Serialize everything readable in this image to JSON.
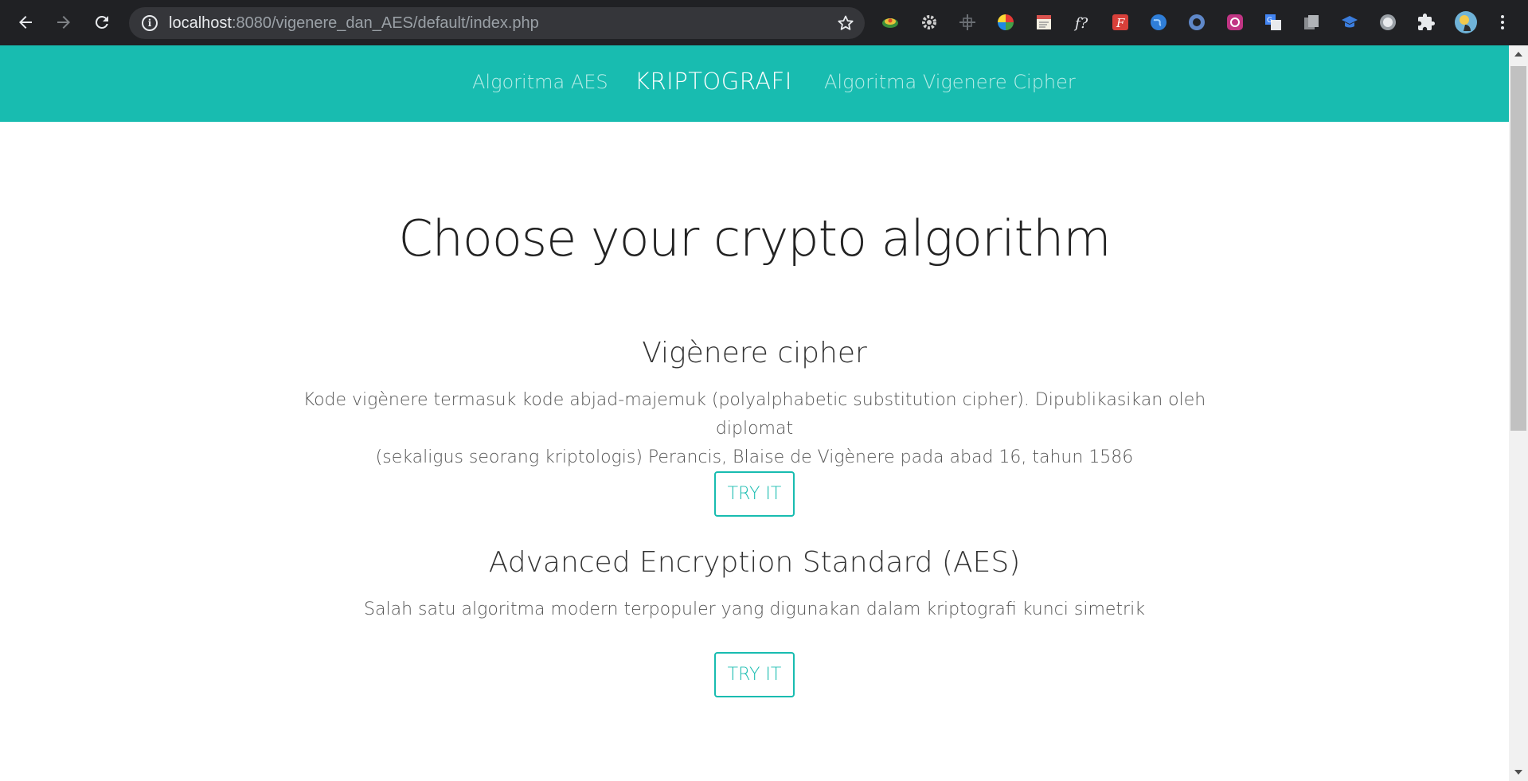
{
  "browser": {
    "url_host": "localhost",
    "url_path": ":8080/vigenere_dan_AES/default/index.php",
    "extensions": [
      "colorful-disc-icon",
      "gear-icon",
      "move-icon",
      "color-wheel-icon",
      "notepad-icon",
      "font-f-icon",
      "fontface-icon",
      "globe-icon",
      "swirl-icon",
      "instagram-like-icon",
      "translate-icon",
      "copy-icon",
      "graduation-cap-icon",
      "circle-icon",
      "puzzle-icon",
      "avatar"
    ]
  },
  "nav": {
    "left_link": "Algoritma AES",
    "brand": "KRIPTOGRAFI",
    "right_link": "Algoritma Vigenere Cipher"
  },
  "main": {
    "title": "Choose your crypto algorithm",
    "sections": [
      {
        "title": "Vigènere cipher",
        "desc_line1": "Kode vigènere termasuk kode abjad-majemuk (polyalphabetic substitution cipher). Dipublikasikan oleh diplomat",
        "desc_line2": "(sekaligus seorang kriptologis) Perancis, Blaise de Vigènere pada abad 16, tahun 1586",
        "button": "TRY IT"
      },
      {
        "title": "Advanced Encryption Standard (AES)",
        "desc_line1": "Salah satu algoritma modern terpopuler yang digunakan dalam kriptografi kunci simetrik",
        "button": "TRY IT"
      }
    ]
  },
  "colors": {
    "accent": "#18bcb0",
    "toolbar": "#202124"
  }
}
